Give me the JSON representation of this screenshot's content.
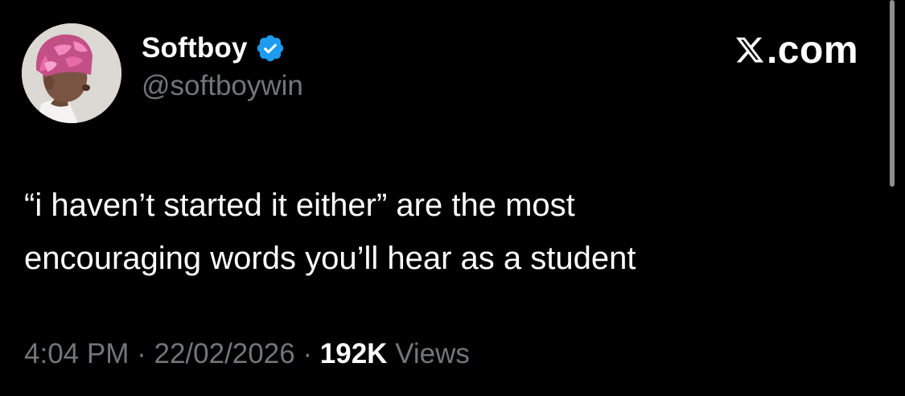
{
  "author": {
    "display_name": "Softboy",
    "handle": "@softboywin",
    "verified": true,
    "avatar_icon": "profile-avatar-photo"
  },
  "brand": {
    "icon": "x-logo-icon",
    "text": ".com"
  },
  "tweet": {
    "text_line_1": "“i haven’t started it either” are the most",
    "text_line_2": "encouraging words you’ll hear as a student"
  },
  "meta": {
    "time": "4:04 PM",
    "separator": "·",
    "date": "22/02/2026",
    "views_count": "192K",
    "views_label": "Views"
  },
  "colors": {
    "background": "#000000",
    "text_primary": "#ffffff",
    "text_secondary": "#71767b",
    "verified_blue": "#1d9bf0",
    "beanie_pink": "#e86aa8"
  }
}
